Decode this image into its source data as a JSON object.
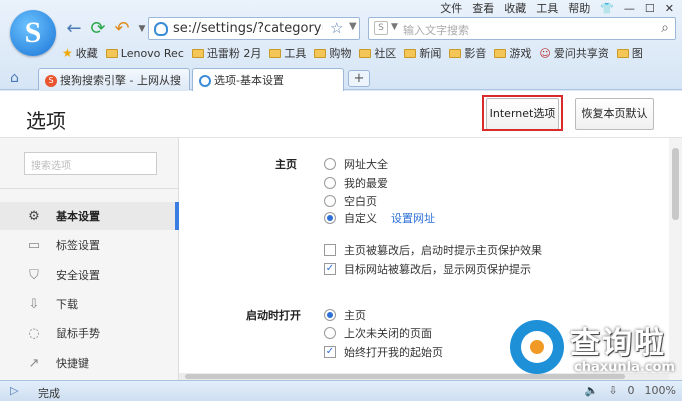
{
  "menubar": [
    "文件",
    "查看",
    "收藏",
    "工具",
    "帮助"
  ],
  "menubar_icon": "shirt-icon",
  "address": {
    "url": "se://settings/?category=gen"
  },
  "search": {
    "placeholder": "输入文字搜索"
  },
  "favorites": [
    {
      "label": "收藏",
      "icon": "star-icon"
    },
    {
      "label": "Lenovo Rec",
      "icon": "folder-icon"
    },
    {
      "label": "迅雷粉 2月",
      "icon": "folder-icon"
    },
    {
      "label": "工具",
      "icon": "folder-icon"
    },
    {
      "label": "购物",
      "icon": "folder-icon"
    },
    {
      "label": "社区",
      "icon": "folder-icon"
    },
    {
      "label": "新闻",
      "icon": "folder-icon"
    },
    {
      "label": "影音",
      "icon": "folder-icon"
    },
    {
      "label": "游戏",
      "icon": "folder-icon"
    },
    {
      "label": "爱问共享资",
      "icon": "user-icon"
    },
    {
      "label": "图",
      "icon": "folder-icon"
    }
  ],
  "tabs": [
    {
      "label": "搜狗搜索引擎 - 上网从搜"
    },
    {
      "label": "选项-基本设置"
    }
  ],
  "newtab": "+",
  "page": {
    "title": "选项",
    "internet_options": "Internet选项",
    "restore_defaults": "恢复本页默认"
  },
  "sidebar": {
    "search_placeholder": "搜索选项",
    "items": [
      {
        "label": "基本设置",
        "icon": "gear-icon",
        "glyph": "⚙"
      },
      {
        "label": "标签设置",
        "icon": "tab-icon",
        "glyph": "▭"
      },
      {
        "label": "安全设置",
        "icon": "shield-icon",
        "glyph": "⛉"
      },
      {
        "label": "下载",
        "icon": "download-icon",
        "glyph": "⇩"
      },
      {
        "label": "鼠标手势",
        "icon": "mouse-icon",
        "glyph": "◌"
      },
      {
        "label": "快捷键",
        "icon": "shortcut-icon",
        "glyph": "↗"
      }
    ]
  },
  "homepage": {
    "label": "主页",
    "options": [
      "网址大全",
      "我的最爱",
      "空白页",
      "自定义"
    ],
    "selected": 3,
    "set_url_link": "设置网址",
    "checks": [
      {
        "label": "主页被篡改后，启动时提示主页保护效果",
        "checked": false
      },
      {
        "label": "目标网站被篡改后，显示网页保护提示",
        "checked": true
      }
    ]
  },
  "startup": {
    "label": "启动时打开",
    "options": [
      "主页",
      "上次未关闭的页面"
    ],
    "selected": 0,
    "check": {
      "label": "始终打开我的起始页",
      "checked": true
    }
  },
  "watermark": {
    "cn": "查询啦",
    "en": "chaxunla.com"
  },
  "status": {
    "text": "完成",
    "badge": "0",
    "zoom": "100%"
  }
}
